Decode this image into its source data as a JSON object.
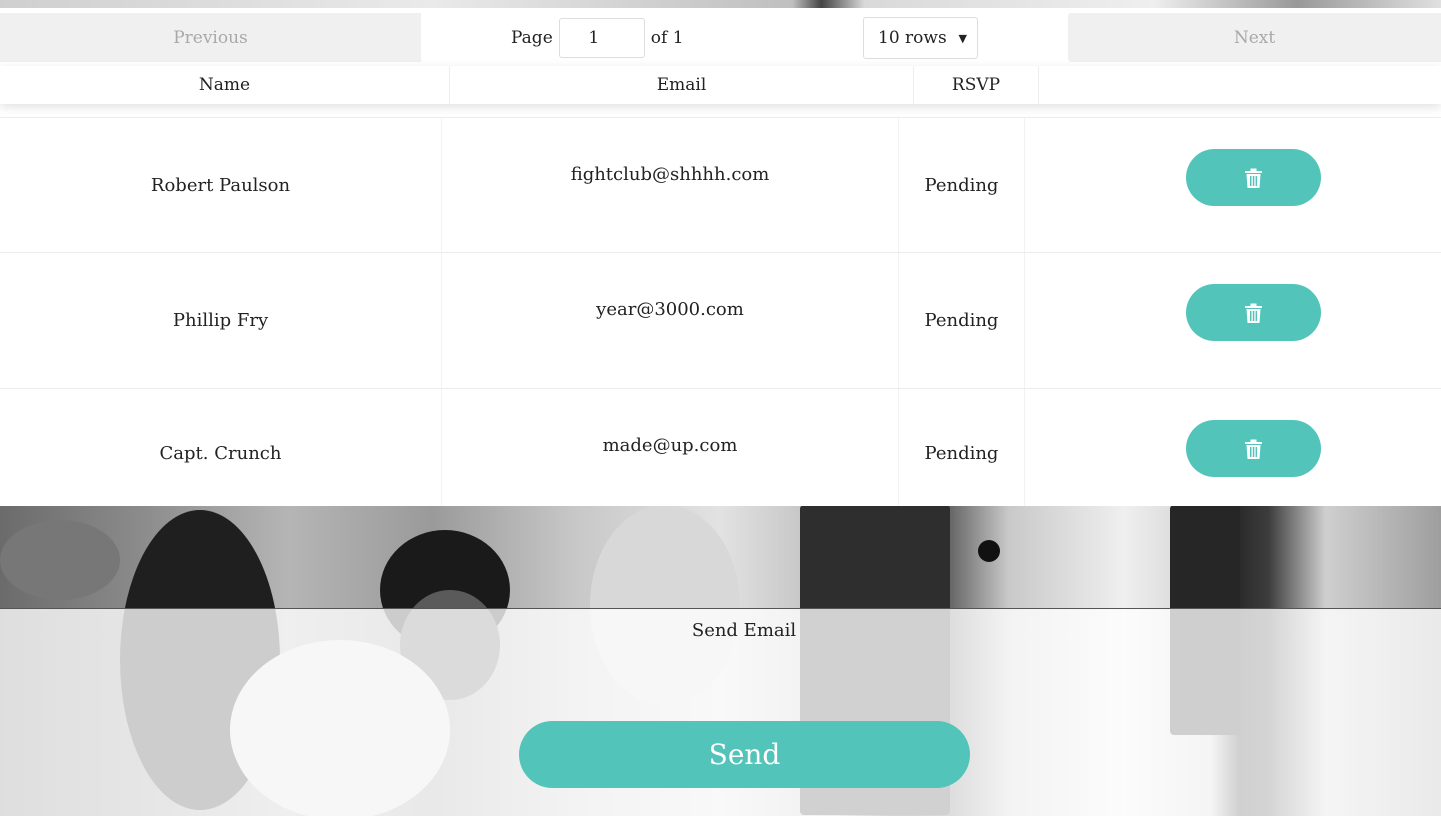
{
  "pagination": {
    "previous_label": "Previous",
    "next_label": "Next",
    "page_label": "Page",
    "page_value": "1",
    "of_label": "of 1",
    "rows_option": "10 rows",
    "rows_arrow": "▼"
  },
  "table": {
    "headers": {
      "name": "Name",
      "email": "Email",
      "rsvp": "RSVP"
    },
    "rows": [
      {
        "name": "Robert Paulson",
        "email": "fightclub@shhhh.com",
        "rsvp": "Pending"
      },
      {
        "name": "Phillip Fry",
        "email": "year@3000.com",
        "rsvp": "Pending"
      },
      {
        "name": "Capt. Crunch",
        "email": "made@up.com",
        "rsvp": "Pending"
      }
    ],
    "delete_icon": "trash-icon"
  },
  "email_section": {
    "title": "Send Email",
    "send_label": "Send"
  },
  "colors": {
    "accent": "#52c4b9",
    "disabled_text": "#a9a9a9"
  }
}
